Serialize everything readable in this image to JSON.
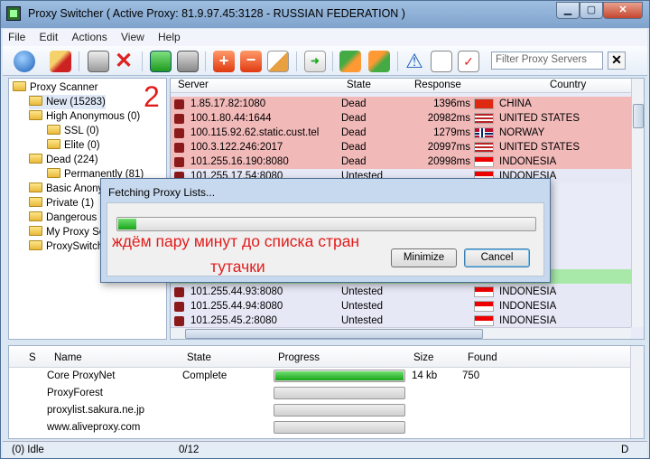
{
  "window": {
    "title": "Proxy Switcher  ( Active Proxy: 81.9.97.45:3128 - RUSSIAN FEDERATION )"
  },
  "menu": [
    "File",
    "Edit",
    "Actions",
    "View",
    "Help"
  ],
  "filter": {
    "placeholder": "Filter Proxy Servers"
  },
  "annotation_number": "2",
  "tree": [
    {
      "label": "Proxy Scanner",
      "level": 0
    },
    {
      "label": "New (15283)",
      "level": 1
    },
    {
      "label": "High Anonymous (0)",
      "level": 1
    },
    {
      "label": "SSL (0)",
      "level": 2
    },
    {
      "label": "Elite (0)",
      "level": 2
    },
    {
      "label": "Dead (224)",
      "level": 1
    },
    {
      "label": "Permanently (81)",
      "level": 2
    },
    {
      "label": "Basic Anonym",
      "level": 1
    },
    {
      "label": "Private (1)",
      "level": 1
    },
    {
      "label": "Dangerous (",
      "level": 1
    },
    {
      "label": "My Proxy Se",
      "level": 1
    },
    {
      "label": "ProxySwitch",
      "level": 1
    }
  ],
  "grid": {
    "columns": [
      "Server",
      "State",
      "Response",
      "Country"
    ],
    "rows": [
      {
        "server": "1.85.17.82:1080",
        "state": "Dead",
        "response": "1396ms",
        "country": "CHINA",
        "style": "dead",
        "flag": "cn"
      },
      {
        "server": "100.1.80.44:1644",
        "state": "Dead",
        "response": "20982ms",
        "country": "UNITED STATES",
        "style": "dead",
        "flag": "us"
      },
      {
        "server": "100.115.92.62.static.cust.tel",
        "state": "Dead",
        "response": "1279ms",
        "country": "NORWAY",
        "style": "dead",
        "flag": "no"
      },
      {
        "server": "100.3.122.246:2017",
        "state": "Dead",
        "response": "20997ms",
        "country": "UNITED STATES",
        "style": "dead",
        "flag": "us"
      },
      {
        "server": "101.255.16.190:8080",
        "state": "Dead",
        "response": "20998ms",
        "country": "INDONESIA",
        "style": "dead",
        "flag": "id"
      },
      {
        "server": "101.255.17.54:8080",
        "state": "Untested",
        "response": "",
        "country": "INDONESIA",
        "style": "blue",
        "flag": "id"
      },
      {
        "server": "101.255.44.93:8080",
        "state": "Untested",
        "response": "",
        "country": "INDONESIA",
        "style": "blue",
        "flag": "id"
      },
      {
        "server": "101.255.44.94:8080",
        "state": "Untested",
        "response": "",
        "country": "INDONESIA",
        "style": "blue",
        "flag": "id"
      },
      {
        "server": "101.255.45.2:8080",
        "state": "Untested",
        "response": "",
        "country": "INDONESIA",
        "style": "blue",
        "flag": "id"
      }
    ]
  },
  "dialog": {
    "title": "Fetching Proxy Lists...",
    "progress": 0.04,
    "overlay_line1": "ждём пару минут до списка стран",
    "overlay_line2": "тутачки",
    "minimize_label": "Minimize",
    "cancel_label": "Cancel"
  },
  "sources": {
    "columns": [
      "S",
      "Name",
      "State",
      "Progress",
      "Size",
      "Found"
    ],
    "rows": [
      {
        "name": "Core ProxyNet",
        "state": "Complete",
        "progress": 1.0,
        "size": "14 kb",
        "found": "750"
      },
      {
        "name": "ProxyForest",
        "state": "",
        "progress": 0,
        "size": "",
        "found": ""
      },
      {
        "name": "proxylist.sakura.ne.jp",
        "state": "",
        "progress": 0,
        "size": "",
        "found": ""
      },
      {
        "name": "www.aliveproxy.com",
        "state": "",
        "progress": 0,
        "size": "",
        "found": ""
      }
    ]
  },
  "status": {
    "left": "(0) Idle",
    "middle": "0/12",
    "right": "D"
  },
  "colors": {
    "dead_row": "#f2b9b9",
    "untested_row": "#e6e8f6",
    "highlight_row": "#a8e8a8",
    "annotation": "#e21c1c"
  }
}
